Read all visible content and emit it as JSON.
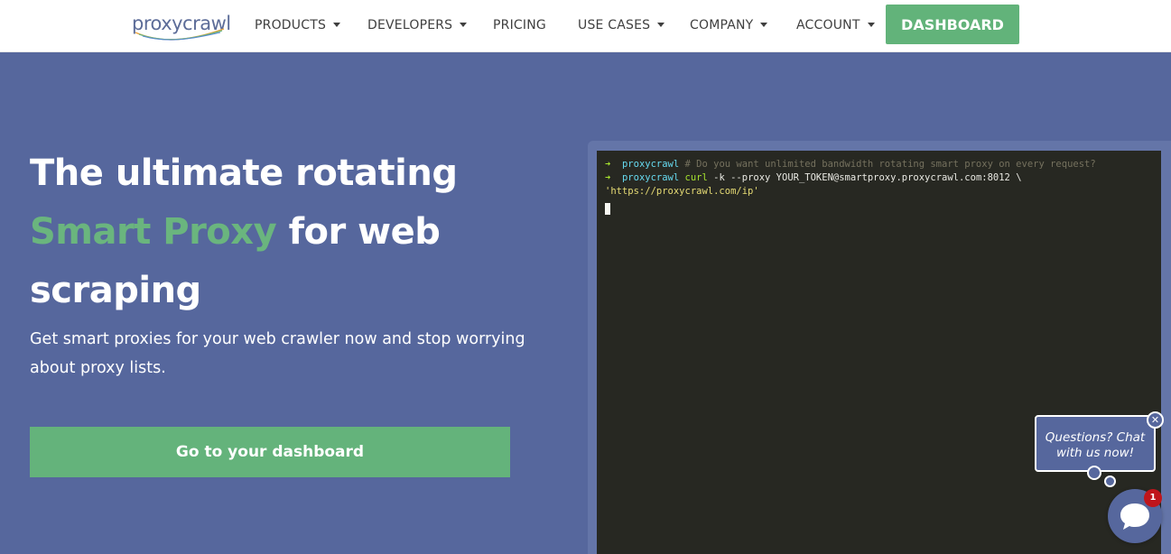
{
  "header": {
    "logo_text": "proxycrawl",
    "nav": [
      {
        "label": "PRODUCTS",
        "dropdown": true
      },
      {
        "label": "DEVELOPERS",
        "dropdown": true
      },
      {
        "label": "PRICING",
        "dropdown": false
      },
      {
        "label": "USE CASES",
        "dropdown": true
      },
      {
        "label": "COMPANY",
        "dropdown": true
      },
      {
        "label": "ACCOUNT",
        "dropdown": true
      }
    ],
    "dashboard_label": "DASHBOARD"
  },
  "hero": {
    "title_line1": "The ultimate rotating",
    "title_accent": "Smart Proxy",
    "title_rest": " for web",
    "title_line3": "scraping",
    "subtitle": "Get smart proxies for your web crawler now and stop worrying about proxy lists.",
    "cta_label": "Go to your dashboard"
  },
  "terminal": {
    "arrow": "➜",
    "host": "proxycrawl",
    "line1_comment": "# Do you want unlimited bandwidth rotating smart proxy on every request?",
    "line2_cmd": "curl",
    "line2_args": " -k --proxy YOUR_TOKEN@smartproxy.proxycrawl.com:8012 \\",
    "line3_str": "'https://proxycrawl.com/ip'"
  },
  "chat": {
    "prompt": "Questions? Chat with us now!",
    "close_glyph": "✕",
    "badge_count": "1"
  },
  "colors": {
    "hero_bg": "#56679d",
    "accent_green": "#62b37a",
    "terminal_bg": "#272822"
  }
}
